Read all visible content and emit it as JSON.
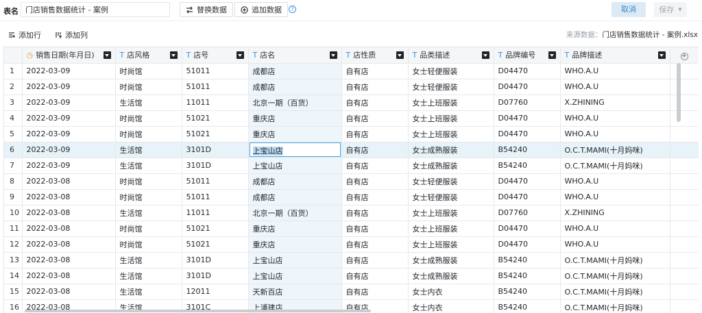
{
  "header": {
    "table_name_label": "表名",
    "table_name_value": "门店销售数据统计 - 案例",
    "replace_label": "替换数据",
    "append_label": "追加数据",
    "help_glyph": "?",
    "cancel_label": "取消",
    "save_label": "保存"
  },
  "actions": {
    "add_row_label": "添加行",
    "add_col_label": "添加列",
    "source_prefix": "来源数据：",
    "source_file": "门店销售数据统计 - 案例.xlsx"
  },
  "columns": [
    {
      "type_icon": "clock-icon",
      "type_glyph": "◷",
      "label": "销售日期(年月日)"
    },
    {
      "type_icon": "text-type-icon",
      "type_glyph": "T",
      "label": "店风格"
    },
    {
      "type_icon": "text-type-icon",
      "type_glyph": "T",
      "label": "店号"
    },
    {
      "type_icon": "text-type-icon",
      "type_glyph": "T",
      "label": "店名"
    },
    {
      "type_icon": "text-type-icon",
      "type_glyph": "T",
      "label": "店性质"
    },
    {
      "type_icon": "text-type-icon",
      "type_glyph": "T",
      "label": "品类描述"
    },
    {
      "type_icon": "text-type-icon",
      "type_glyph": "T",
      "label": "品牌编号"
    },
    {
      "type_icon": "text-type-icon",
      "type_glyph": "T",
      "label": "品牌描述"
    }
  ],
  "rows": [
    [
      "1",
      "2022-03-09",
      "时尚馆",
      "51011",
      "成都店",
      "自有店",
      "女士轻便服装",
      "D04470",
      "WHO.A.U"
    ],
    [
      "2",
      "2022-03-09",
      "时尚馆",
      "51011",
      "成都店",
      "自有店",
      "女士轻便服装",
      "D04470",
      "WHO.A.U"
    ],
    [
      "3",
      "2022-03-09",
      "生活馆",
      "11011",
      "北京一期（百货）",
      "自有店",
      "女士上班服装",
      "D07760",
      "X.ZHINING"
    ],
    [
      "4",
      "2022-03-09",
      "时尚馆",
      "51021",
      "重庆店",
      "自有店",
      "女士上班服装",
      "D04470",
      "WHO.A.U"
    ],
    [
      "5",
      "2022-03-09",
      "时尚馆",
      "51021",
      "重庆店",
      "自有店",
      "女士上班服装",
      "D04470",
      "WHO.A.U"
    ],
    [
      "6",
      "2022-03-09",
      "生活馆",
      "3101D",
      "上宝山店",
      "自有店",
      "女士成熟服装",
      "B54240",
      "O.C.T.MAMI(十月妈咪)"
    ],
    [
      "7",
      "2022-03-09",
      "生活馆",
      "3101D",
      "上宝山店",
      "自有店",
      "女士成熟服装",
      "B54240",
      "O.C.T.MAMI(十月妈咪)"
    ],
    [
      "8",
      "2022-03-08",
      "时尚馆",
      "51011",
      "成都店",
      "自有店",
      "女士轻便服装",
      "D04470",
      "WHO.A.U"
    ],
    [
      "9",
      "2022-03-08",
      "时尚馆",
      "51011",
      "成都店",
      "自有店",
      "女士轻便服装",
      "D04470",
      "WHO.A.U"
    ],
    [
      "10",
      "2022-03-08",
      "生活馆",
      "11011",
      "北京一期（百货）",
      "自有店",
      "女士上班服装",
      "D07760",
      "X.ZHINING"
    ],
    [
      "11",
      "2022-03-08",
      "时尚馆",
      "51021",
      "重庆店",
      "自有店",
      "女士上班服装",
      "D04470",
      "WHO.A.U"
    ],
    [
      "12",
      "2022-03-08",
      "时尚馆",
      "51021",
      "重庆店",
      "自有店",
      "女士上班服装",
      "D04470",
      "WHO.A.U"
    ],
    [
      "13",
      "2022-03-08",
      "生活馆",
      "3101D",
      "上宝山店",
      "自有店",
      "女士成熟服装",
      "B54240",
      "O.C.T.MAMI(十月妈咪)"
    ],
    [
      "14",
      "2022-03-08",
      "生活馆",
      "3101D",
      "上宝山店",
      "自有店",
      "女士成熟服装",
      "B54240",
      "O.C.T.MAMI(十月妈咪)"
    ],
    [
      "15",
      "2022-03-08",
      "生活馆",
      "12011",
      "天新百店",
      "自有店",
      "女士内衣",
      "B54240",
      "O.C.T.MAMI(十月妈咪)"
    ],
    [
      "16",
      "2022-03-08",
      "生活馆",
      "3101C",
      "上浦建店",
      "自有店",
      "女士内衣",
      "B54240",
      "O.C.T.MAMI(十月妈咪)"
    ]
  ],
  "selection": {
    "row_number": "6",
    "column_label": "店名"
  },
  "colors": {
    "accent": "#3a8ee6",
    "selected_row": "#e7f2f9",
    "store_column": "#eef6fb"
  }
}
